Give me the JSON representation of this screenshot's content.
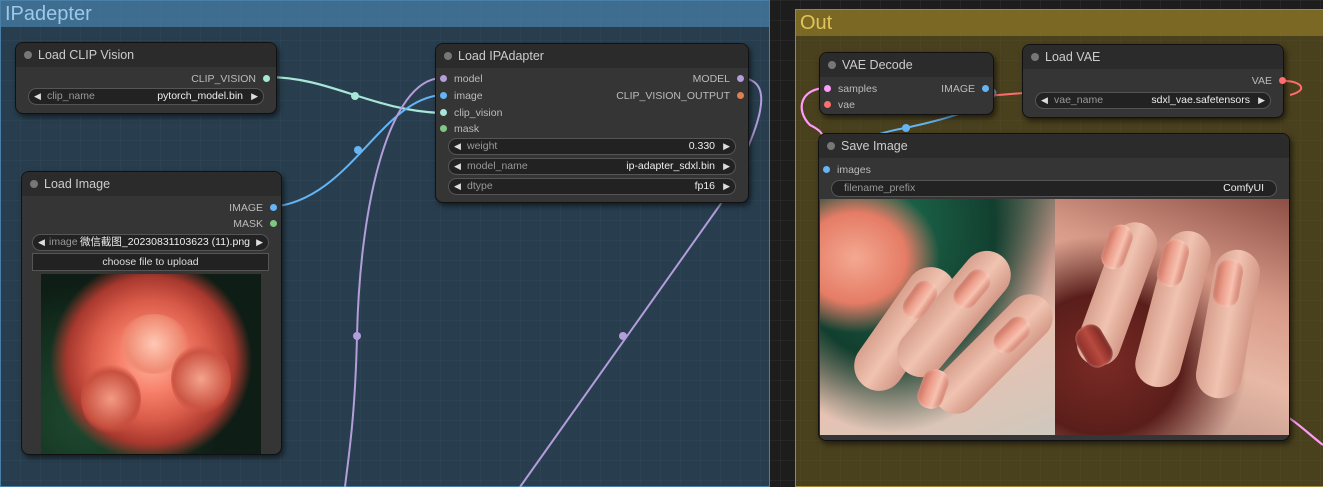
{
  "groups": {
    "ipadapter_title": "IPadepter",
    "out_title": "Out"
  },
  "nodes": {
    "load_clip_vision": {
      "title": "Load CLIP Vision",
      "output": "CLIP_VISION",
      "clip_name_label": "clip_name",
      "clip_name_value": "pytorch_model.bin"
    },
    "load_image": {
      "title": "Load Image",
      "output_image": "IMAGE",
      "output_mask": "MASK",
      "image_label": "image",
      "image_value": "微信截图_20230831103623 (11).png",
      "upload_button": "choose file to upload"
    },
    "load_ipadapter": {
      "title": "Load IPAdapter",
      "inputs": [
        "model",
        "image",
        "clip_vision",
        "mask"
      ],
      "output_model": "MODEL",
      "output_clip": "CLIP_VISION_OUTPUT",
      "weight_label": "weight",
      "weight_value": "0.330",
      "model_name_label": "model_name",
      "model_name_value": "ip-adapter_sdxl.bin",
      "dtype_label": "dtype",
      "dtype_value": "fp16"
    },
    "vae_decode": {
      "title": "VAE Decode",
      "input_samples": "samples",
      "input_vae": "vae",
      "output": "IMAGE"
    },
    "load_vae": {
      "title": "Load VAE",
      "output": "VAE",
      "vae_name_label": "vae_name",
      "vae_name_value": "sdxl_vae.safetensors"
    },
    "save_image": {
      "title": "Save Image",
      "input_images": "images",
      "filename_prefix_label": "filename_prefix",
      "filename_prefix_value": "ComfyUI"
    }
  },
  "colors": {
    "clip_vision_wire": "#a8e6d8",
    "image_wire": "#64b5f6",
    "model_wire": "#b39ddb",
    "vae_wire": "#ff6e6e",
    "latent_wire": "#ff9cf9",
    "mask_pin": "#81c784",
    "group_ip": "#38698c",
    "group_out": "#8c7628"
  }
}
